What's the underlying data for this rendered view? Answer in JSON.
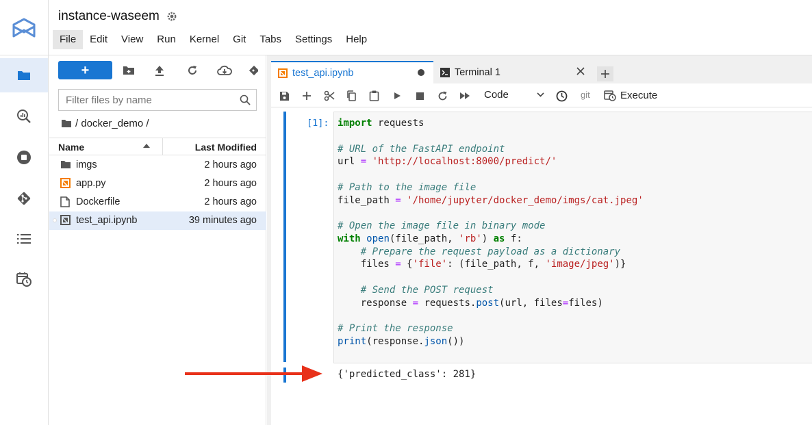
{
  "colors": {
    "accent": "#1976d2",
    "arrow": "#e8311a",
    "selected": "#e3ecf9"
  },
  "header": {
    "title": "instance-waseem"
  },
  "menu": [
    "File",
    "Edit",
    "View",
    "Run",
    "Kernel",
    "Git",
    "Tabs",
    "Settings",
    "Help"
  ],
  "activity_icons": [
    "folder-icon",
    "search-chart-icon",
    "stop-circle-icon",
    "git-icon",
    "list-icon",
    "calendar-clock-icon"
  ],
  "filebrowser": {
    "new_label": "+",
    "filter_placeholder": "Filter files by name",
    "breadcrumb": "/ docker_demo /",
    "columns": {
      "name": "Name",
      "modified": "Last Modified"
    },
    "files": [
      {
        "name": "imgs",
        "modified": "2 hours ago",
        "icon": "folder-icon"
      },
      {
        "name": "app.py",
        "modified": "2 hours ago",
        "icon": "python-file-icon"
      },
      {
        "name": "Dockerfile",
        "modified": "2 hours ago",
        "icon": "file-icon"
      },
      {
        "name": "test_api.ipynb",
        "modified": "39 minutes ago",
        "icon": "notebook-icon"
      }
    ]
  },
  "tabs": [
    {
      "label": "test_api.ipynb"
    },
    {
      "label": "Terminal 1"
    }
  ],
  "notebook": {
    "cell_type": "Code",
    "git_label": "git",
    "execute_label": "Execute",
    "prompt": "[1]:",
    "output": "{'predicted_class': 281}"
  }
}
